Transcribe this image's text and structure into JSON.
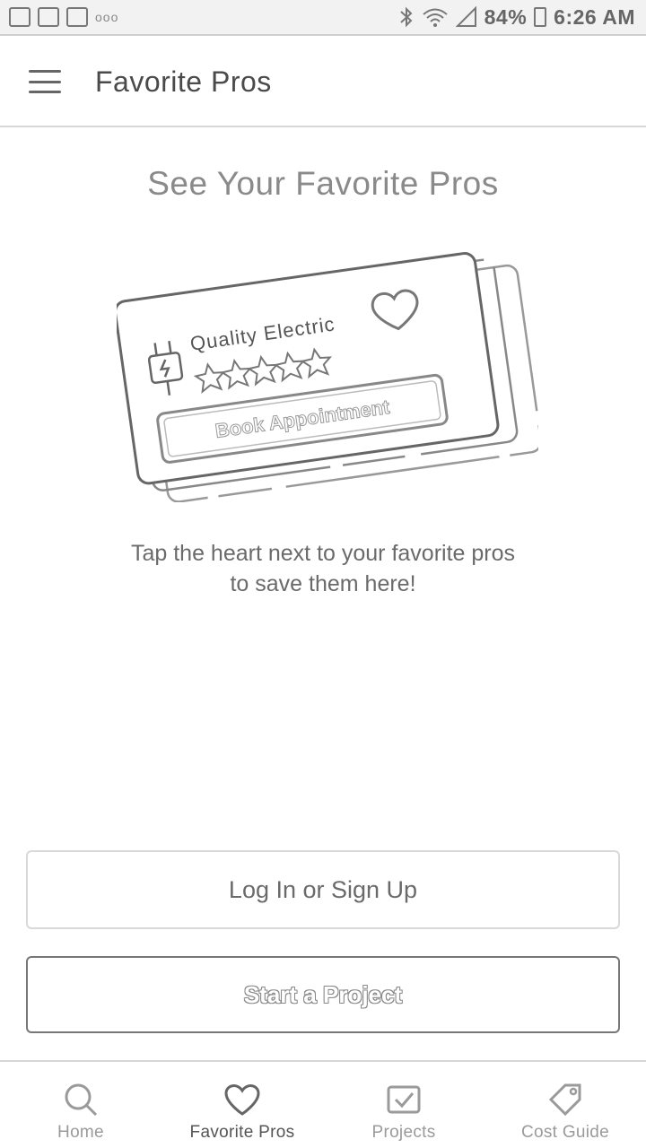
{
  "status_bar": {
    "left_icons": [
      "photo-icon",
      "check-icon",
      "mail-icon"
    ],
    "dots": "ooo",
    "battery": "84%",
    "time": "6:26 AM",
    "right_icons": [
      "bluetooth-icon",
      "wifi-icon",
      "signal-icon",
      "battery-icon"
    ]
  },
  "app_bar": {
    "title": "Favorite Pros",
    "menu_icon": "hamburger-menu-icon"
  },
  "main": {
    "heading": "See Your Favorite Pros",
    "illustration": {
      "business_name": "Quality Electric",
      "button_text": "Book Appointment",
      "rating_stars": 5
    },
    "description_line1": "Tap the heart next to your favorite pros",
    "description_line2": "to save them here!",
    "login_button": "Log In or Sign Up",
    "start_button": "Start a Project"
  },
  "bottom_nav": {
    "items": [
      {
        "label": "Home",
        "icon": "search-icon",
        "active": false
      },
      {
        "label": "Favorite Pros",
        "icon": "heart-icon",
        "active": true
      },
      {
        "label": "Projects",
        "icon": "projects-icon",
        "active": false
      },
      {
        "label": "Cost Guide",
        "icon": "tag-icon",
        "active": false
      }
    ]
  },
  "colors": {
    "primary_text": "#4a4a4a",
    "muted_text": "#8a8a8a",
    "border": "#d7d7d7"
  }
}
